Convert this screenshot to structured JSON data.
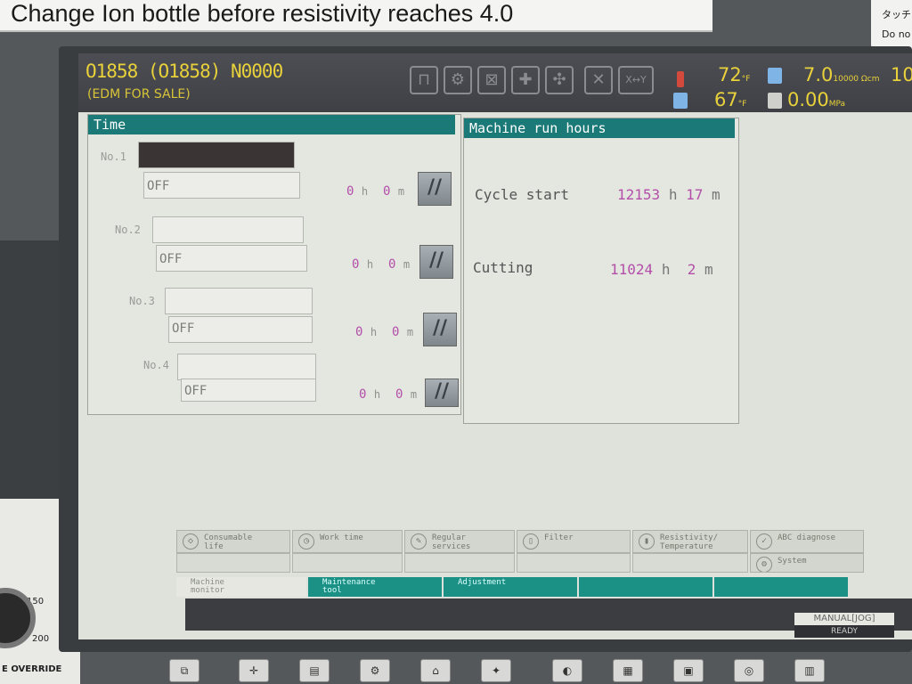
{
  "machine": {
    "top_label": "Change Ion bottle before resistivity reaches 4.0",
    "corner_label": [
      "タッチ",
      "Do no"
    ],
    "override_label": "E OVERRIDE",
    "dial_marks": [
      "150",
      "200"
    ]
  },
  "header": {
    "program_line": "O1858  (O1858)  N0000",
    "program_name": "(EDM FOR SALE)",
    "temp1": "72",
    "temp1_unit": "°F",
    "temp2": "67",
    "temp2_unit": "°F",
    "resistivity": "7.0",
    "resistivity_unit": "10000 Ωcm",
    "pressure": "0.00",
    "pressure_unit": "MPa",
    "extra": "10"
  },
  "time_panel": {
    "title": "Time",
    "rows": [
      {
        "label": "No.1",
        "state": "OFF",
        "h": "0",
        "m": "0"
      },
      {
        "label": "No.2",
        "state": "OFF",
        "h": "0",
        "m": "0"
      },
      {
        "label": "No.3",
        "state": "OFF",
        "h": "0",
        "m": "0"
      },
      {
        "label": "No.4",
        "state": "OFF",
        "h": "0",
        "m": "0"
      }
    ],
    "h_unit": "h",
    "m_unit": "m",
    "reset_glyph": "//"
  },
  "run_panel": {
    "title": "Machine run hours",
    "cycle_label": "Cycle start",
    "cycle_h": "12153",
    "cycle_m": "17",
    "cutting_label": "Cutting",
    "cutting_h": "11024",
    "cutting_m": "2",
    "h_unit": "h",
    "m_unit": "m"
  },
  "softkeys": {
    "consumable": "Consumable\nlife",
    "work_time": "Work time",
    "regular": "Regular\nservices",
    "filter": "Filter",
    "resistivity": "Resistivity/\nTemperature",
    "abc": "ABC diagnose",
    "system": "System"
  },
  "tabs": {
    "machine_monitor": "Machine\nmonitor",
    "maintenance": "Maintenance\ntool",
    "adjustment": "Adjustment"
  },
  "status": {
    "mode": "MANUAL[JOG]",
    "ready": "READY"
  }
}
